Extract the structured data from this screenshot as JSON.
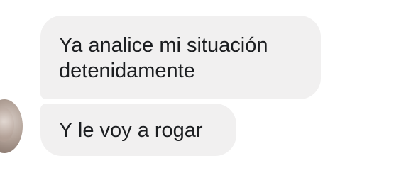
{
  "messages": [
    {
      "lines": [
        "Ya analice mi situación",
        "detenidamente"
      ]
    },
    {
      "lines": [
        "Y le voy a rogar"
      ]
    }
  ],
  "colors": {
    "bubble_background": "#f1f0f0",
    "text": "#1c1e21",
    "page_background": "#ffffff"
  }
}
